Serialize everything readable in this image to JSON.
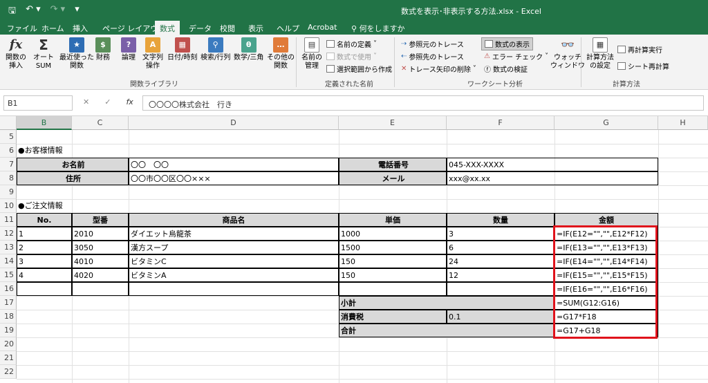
{
  "titlebar": {
    "title": "数式を表示･非表示する方法.xlsx  -  Excel",
    "qat": [
      "save-icon",
      "undo-icon",
      "redo-icon",
      "customize-icon"
    ]
  },
  "tabs": [
    "ファイル",
    "ホーム",
    "挿入",
    "ページ レイアウト",
    "数式",
    "データ",
    "校閲",
    "表示",
    "ヘルプ",
    "Acrobat",
    "何をしますか"
  ],
  "active_tab": "数式",
  "ribbon": {
    "function_library": {
      "label": "関数ライブラリ",
      "buttons": [
        "関数の\n挿入",
        "オート\nSUM",
        "最近使った\n関数",
        "財務",
        "論理",
        "文字列\n操作",
        "日付/時刻",
        "検索/行列",
        "数学/三角",
        "その他の\n関数"
      ]
    },
    "defined_names": {
      "label": "定義された名前",
      "big": "名前の\n管理",
      "small": [
        "名前の定義",
        "数式で使用",
        "選択範囲から作成"
      ]
    },
    "formula_auditing": {
      "label": "ワークシート分析",
      "small_left": [
        "参照元のトレース",
        "参照先のトレース",
        "トレース矢印の削除"
      ],
      "small_right": [
        "数式の表示",
        "エラー チェック",
        "数式の検証"
      ],
      "big": "ウォッチ\nウィンドウ"
    },
    "calculation": {
      "label": "計算方法",
      "big": "計算方法\nの設定",
      "small": [
        "再計算実行",
        "シート再計算"
      ]
    }
  },
  "formula_bar": {
    "name_box": "B1",
    "fx": "fx",
    "content": "〇〇〇〇株式会社　行き"
  },
  "columns": [
    "B",
    "C",
    "D",
    "E",
    "F",
    "G",
    "H"
  ],
  "rows": [
    "5",
    "6",
    "7",
    "8",
    "9",
    "10",
    "11",
    "12",
    "13",
    "14",
    "15",
    "16",
    "17",
    "18",
    "19",
    "20",
    "21",
    "22"
  ],
  "sheet": {
    "customer_title": "●お客様情報",
    "name_label": "お名前",
    "name_value": "〇〇　〇〇",
    "phone_label": "電話番号",
    "phone_value": "045-XXX-XXXX",
    "address_label": "住所",
    "address_value": "〇〇市〇〇区〇〇×××",
    "mail_label": "メール",
    "mail_value": "xxx@xx.xx",
    "order_title": "●ご注文情報",
    "order_headers": [
      "No.",
      "型番",
      "商品名",
      "単価",
      "数量",
      "金額"
    ],
    "order_rows": [
      [
        "1",
        "2010",
        "ダイエット烏龍茶",
        "1000",
        "3",
        "=IF(E12=\"\",\"\",E12*F12)"
      ],
      [
        "2",
        "3050",
        "漢方スープ",
        "1500",
        "6",
        "=IF(E13=\"\",\"\",E13*F13)"
      ],
      [
        "3",
        "4010",
        "ビタミンC",
        "150",
        "24",
        "=IF(E14=\"\",\"\",E14*F14)"
      ],
      [
        "4",
        "4020",
        "ビタミンA",
        "150",
        "12",
        "=IF(E15=\"\",\"\",E15*F15)"
      ],
      [
        "",
        "",
        "",
        "",
        "",
        "=IF(E16=\"\",\"\",E16*F16)"
      ]
    ],
    "subtotal_label": "小計",
    "subtotal_formula": "=SUM(G12:G16)",
    "tax_label": "消費税",
    "tax_rate": "0.1",
    "tax_formula": "=G17*F18",
    "total_label": "合計",
    "total_formula": "=G17+G18"
  },
  "colors": {
    "excel_green": "#217346",
    "highlight_red": "#e0121b",
    "header_gray": "#d9d9d9"
  }
}
